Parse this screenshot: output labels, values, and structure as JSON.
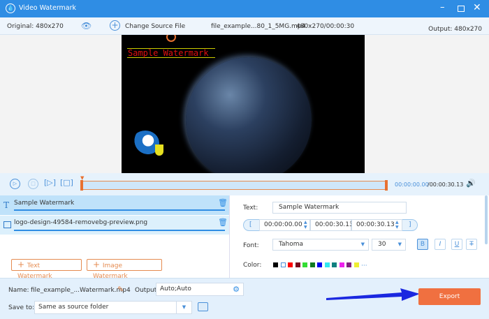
{
  "window": {
    "title": "Video Watermark"
  },
  "infobar": {
    "original": "Original: 480x270",
    "change_source": "Change Source File",
    "file_name": "file_example...80_1_5MG.mp4",
    "file_info": "480x270/00:00:30",
    "output": "Output: 480x270"
  },
  "preview": {
    "watermark_text": "Sample Watermark"
  },
  "controls": {
    "time_current": "00:00:00.00",
    "time_total": "/00:00:30.13"
  },
  "watermarks": [
    {
      "type": "text",
      "label": "Sample Watermark"
    },
    {
      "type": "image",
      "label": "logo-design-49584-removebg-preview.png"
    }
  ],
  "add_buttons": {
    "text": "Text Watermark",
    "image": "Image Watermark"
  },
  "settings": {
    "text_label": "Text:",
    "text_value": "Sample Watermark",
    "start_time": "00:00:00.00",
    "duration": "00:00:30.13",
    "end_time": "00:00:30.13",
    "font_label": "Font:",
    "font_value": "Tahoma",
    "size_value": "30",
    "bold": "B",
    "italic": "I",
    "underline": "U",
    "strike": "T",
    "color_label": "Color:",
    "colors": [
      "#000000",
      "#ffffff",
      "#ff0000",
      "#7a0a1e",
      "#33dd33",
      "#117a22",
      "#0000ee",
      "#33e8f0",
      "#118080",
      "#ee22ee",
      "#802080",
      "#eeee33"
    ],
    "more": "···"
  },
  "bottom": {
    "name_label": "Name:",
    "name_value": "file_example_...Watermark.mp4",
    "output_label": "Output:",
    "output_value": "Auto;Auto",
    "save_label": "Save to:",
    "save_value": "Same as source folder",
    "export": "Export"
  },
  "colors": {
    "accent": "#2f8de4",
    "export": "#f07040"
  }
}
